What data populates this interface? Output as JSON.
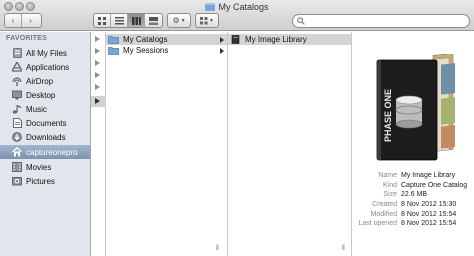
{
  "window": {
    "title": "My Catalogs"
  },
  "toolbar": {
    "back_label": "‹",
    "forward_label": "›",
    "view_buttons": [
      "icon-view",
      "list-view",
      "column-view",
      "cover-flow-view"
    ],
    "action_menu_icon": "gear-icon",
    "arrange_menu_icon": "grid-icon",
    "search_placeholder": ""
  },
  "sidebar": {
    "header": "FAVORITES",
    "items": [
      {
        "label": "All My Files",
        "icon": "all-files-icon"
      },
      {
        "label": "Applications",
        "icon": "applications-icon"
      },
      {
        "label": "AirDrop",
        "icon": "airdrop-icon"
      },
      {
        "label": "Desktop",
        "icon": "desktop-icon"
      },
      {
        "label": "Music",
        "icon": "music-icon"
      },
      {
        "label": "Documents",
        "icon": "documents-icon"
      },
      {
        "label": "Downloads",
        "icon": "downloads-icon"
      },
      {
        "label": "captureonepro",
        "icon": "home-icon",
        "selected": true
      },
      {
        "label": "Movies",
        "icon": "movies-icon"
      },
      {
        "label": "Pictures",
        "icon": "pictures-icon"
      }
    ]
  },
  "columns": {
    "col1": [
      {
        "label": "My Catalogs",
        "selected": true
      },
      {
        "label": "My Sessions",
        "selected": false
      }
    ],
    "col2": [
      {
        "label": "My Image Library",
        "selected": true
      }
    ]
  },
  "preview": {
    "logo_text": "PHASE ONE",
    "info": [
      {
        "label": "Name",
        "value": "My Image Library"
      },
      {
        "label": "Kind",
        "value": "Capture One Catalog"
      },
      {
        "label": "Size",
        "value": "22.6 MB"
      },
      {
        "label": "Created",
        "value": "8 Nov 2012 15:30"
      },
      {
        "label": "Modified",
        "value": "8 Nov 2012 15:54"
      },
      {
        "label": "Last opened",
        "value": "8 Nov 2012 15:54"
      }
    ]
  },
  "colors": {
    "sidebar_bg": "#e1e6ec",
    "sidebar_selected": "#7d93b2",
    "folder_blue": "#79a6d6",
    "row_selected": "#d4d4d4"
  }
}
